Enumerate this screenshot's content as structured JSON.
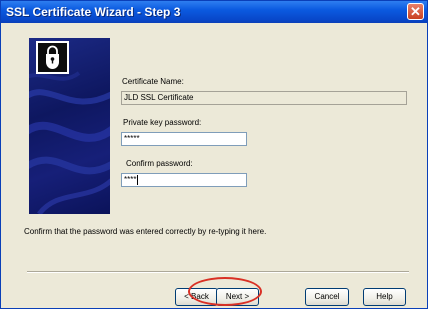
{
  "window": {
    "title": "SSL Certificate Wizard - Step 3",
    "close_glyph": "✕"
  },
  "banner": {
    "icon": "certificate-padlock-icon",
    "background_color": "#101a6e"
  },
  "form": {
    "certificate_name_label": "Certificate Name:",
    "certificate_name_value": "JLD SSL Certificate",
    "private_key_label": "Private key password:",
    "private_key_value": "*****",
    "confirm_label": "Confirm password:",
    "confirm_value": "****"
  },
  "instruction": "Confirm that the password was entered correctly by re-typing it here.",
  "buttons": {
    "back": "< Back",
    "next": "Next >",
    "cancel": "Cancel",
    "help": "Help"
  },
  "annotation": {
    "highlight_color": "#d93025",
    "highlighted": "Next >"
  }
}
